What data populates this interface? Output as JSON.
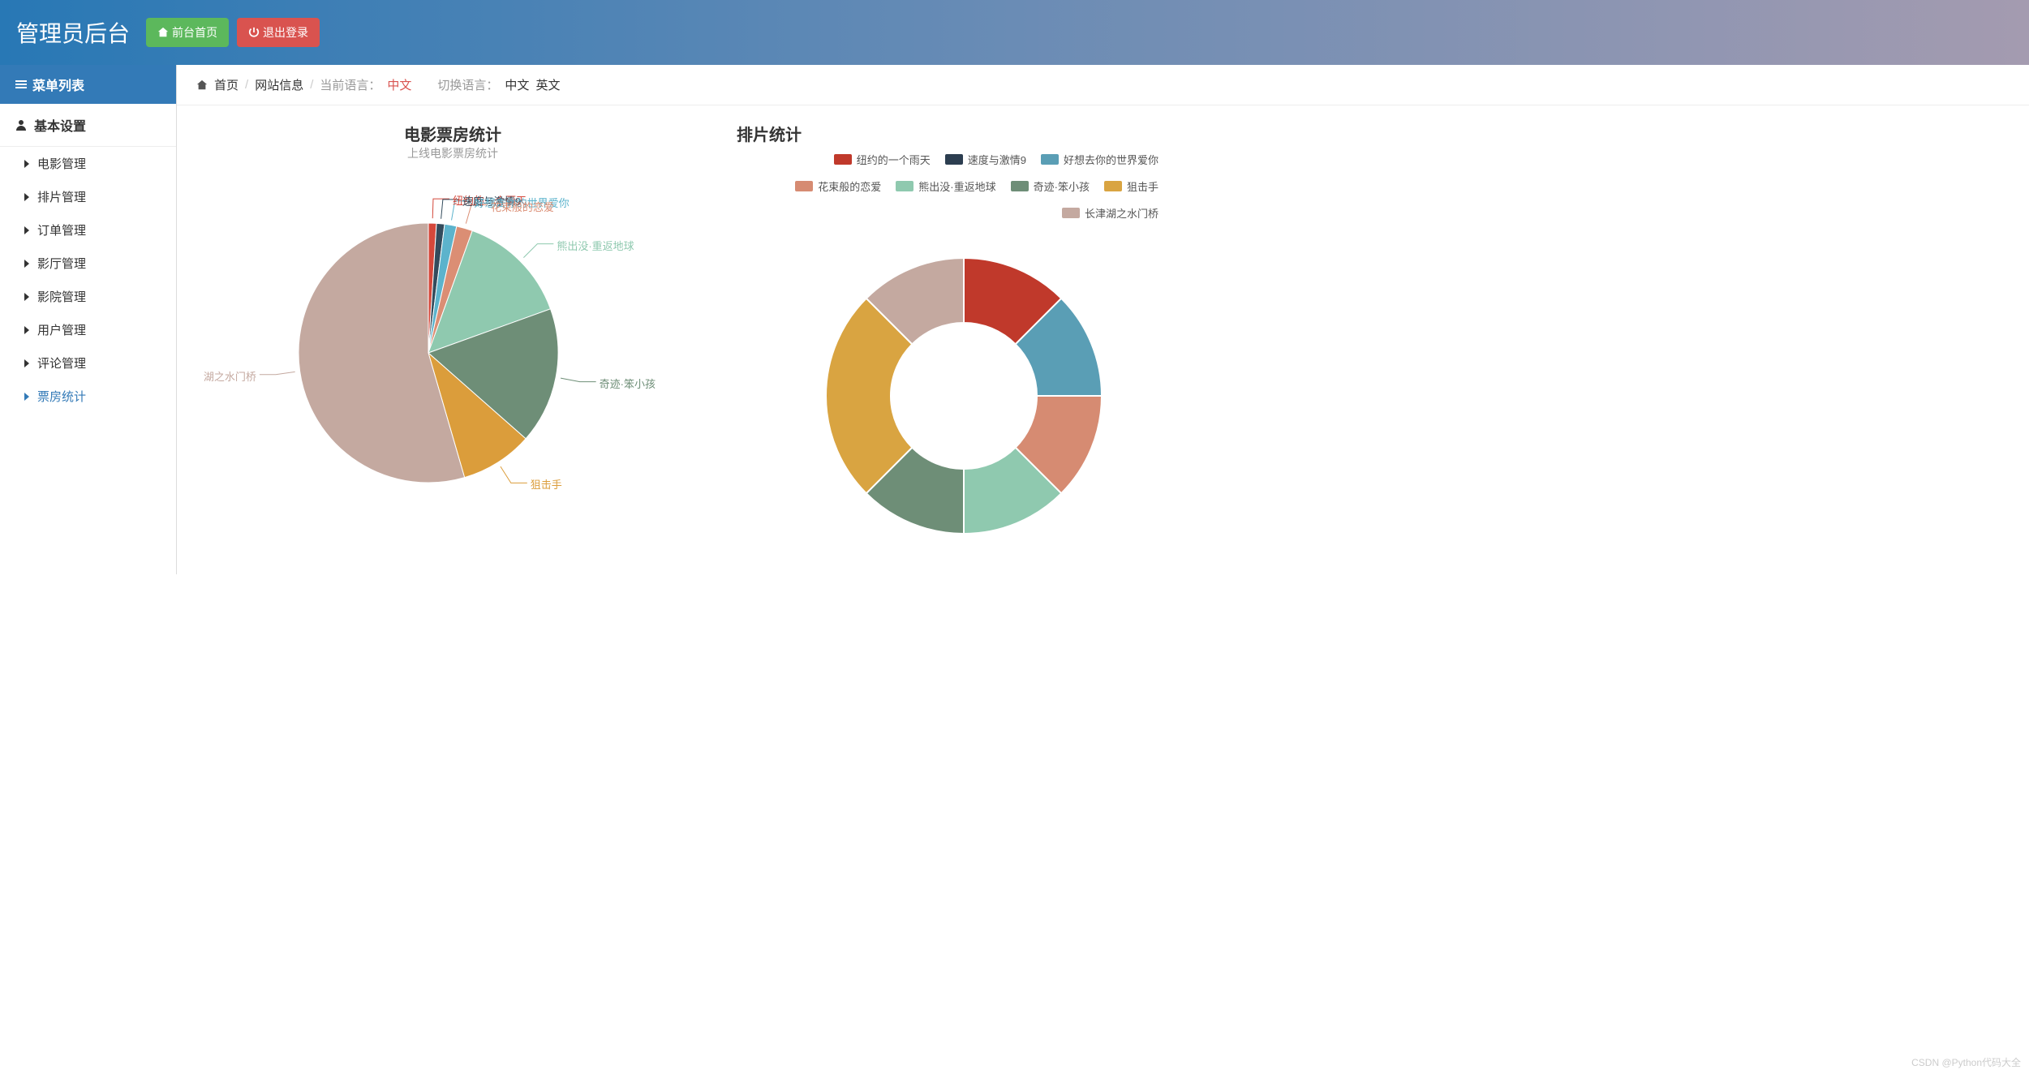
{
  "header": {
    "title": "管理员后台",
    "home_btn": "前台首页",
    "logout_btn": "退出登录"
  },
  "sidebar": {
    "menu_title": "菜单列表",
    "section_title": "基本设置",
    "items": [
      {
        "label": "电影管理"
      },
      {
        "label": "排片管理"
      },
      {
        "label": "订单管理"
      },
      {
        "label": "影厅管理"
      },
      {
        "label": "影院管理"
      },
      {
        "label": "用户管理"
      },
      {
        "label": "评论管理"
      },
      {
        "label": "票房统计"
      }
    ],
    "active_index": 7
  },
  "breadcrumb": {
    "home": "首页",
    "page": "网站信息",
    "lang_label": "当前语言：",
    "lang_current": "中文",
    "switch_label": "切换语言：",
    "lang_zh": "中文",
    "lang_en": "英文"
  },
  "watermark": "CSDN @Python代码大全",
  "chart_data": [
    {
      "type": "pie",
      "title": "电影票房统计",
      "subtitle": "上线电影票房统计",
      "series": [
        {
          "name": "纽约的一个雨天",
          "value": 1,
          "color": "#d4483b"
        },
        {
          "name": "速度与激情9",
          "value": 1,
          "color": "#334b5c"
        },
        {
          "name": "好想去你的世界爱你",
          "value": 1.5,
          "color": "#5cb3cc"
        },
        {
          "name": "花束般的恋爱",
          "value": 2,
          "color": "#db8e74"
        },
        {
          "name": "熊出没·重返地球",
          "value": 14,
          "color": "#8fc9af"
        },
        {
          "name": "奇迹·笨小孩",
          "value": 17,
          "color": "#6e8e77"
        },
        {
          "name": "狙击手",
          "value": 9,
          "color": "#db9d3b"
        },
        {
          "name": "湖之水门桥",
          "value": 54.5,
          "color": "#c4a9a0"
        }
      ],
      "label_colors": {
        "纽约的一个雨天": "#d4483b",
        "速度与激情9": "#334b5c",
        "好想去你的世界爱你": "#5cb3cc",
        "花束般的恋爱": "#db8e74",
        "熊出没·重返地球": "#8fc9af",
        "奇迹·笨小孩": "#6e8e77",
        "狙击手": "#db9d3b",
        "湖之水门桥": "#c4a9a0"
      }
    },
    {
      "type": "donut",
      "title": "排片统计",
      "legend": [
        {
          "name": "纽约的一个雨天",
          "color": "#c0392b"
        },
        {
          "name": "速度与激情9",
          "color": "#2c3e50"
        },
        {
          "name": "好想去你的世界爱你",
          "color": "#5a9eb5"
        },
        {
          "name": "花束般的恋爱",
          "color": "#d68b72"
        },
        {
          "name": "熊出没·重返地球",
          "color": "#8fc9af"
        },
        {
          "name": "奇迹·笨小孩",
          "color": "#6e8e77"
        },
        {
          "name": "狙击手",
          "color": "#d9a441"
        },
        {
          "name": "长津湖之水门桥",
          "color": "#c4a9a0"
        }
      ],
      "series": [
        {
          "name": "纽约的一个雨天",
          "value": 12.5,
          "color": "#c0392b"
        },
        {
          "name": "好想去你的世界爱你",
          "value": 12.5,
          "color": "#5a9eb5"
        },
        {
          "name": "花束般的恋爱",
          "value": 12.5,
          "color": "#d68b72"
        },
        {
          "name": "熊出没·重返地球",
          "value": 12.5,
          "color": "#8fc9af"
        },
        {
          "name": "奇迹·笨小孩",
          "value": 12.5,
          "color": "#6e8e77"
        },
        {
          "name": "狙击手",
          "value": 25,
          "color": "#d9a441"
        },
        {
          "name": "长津湖之水门桥",
          "value": 12.5,
          "color": "#c4a9a0"
        }
      ]
    }
  ]
}
